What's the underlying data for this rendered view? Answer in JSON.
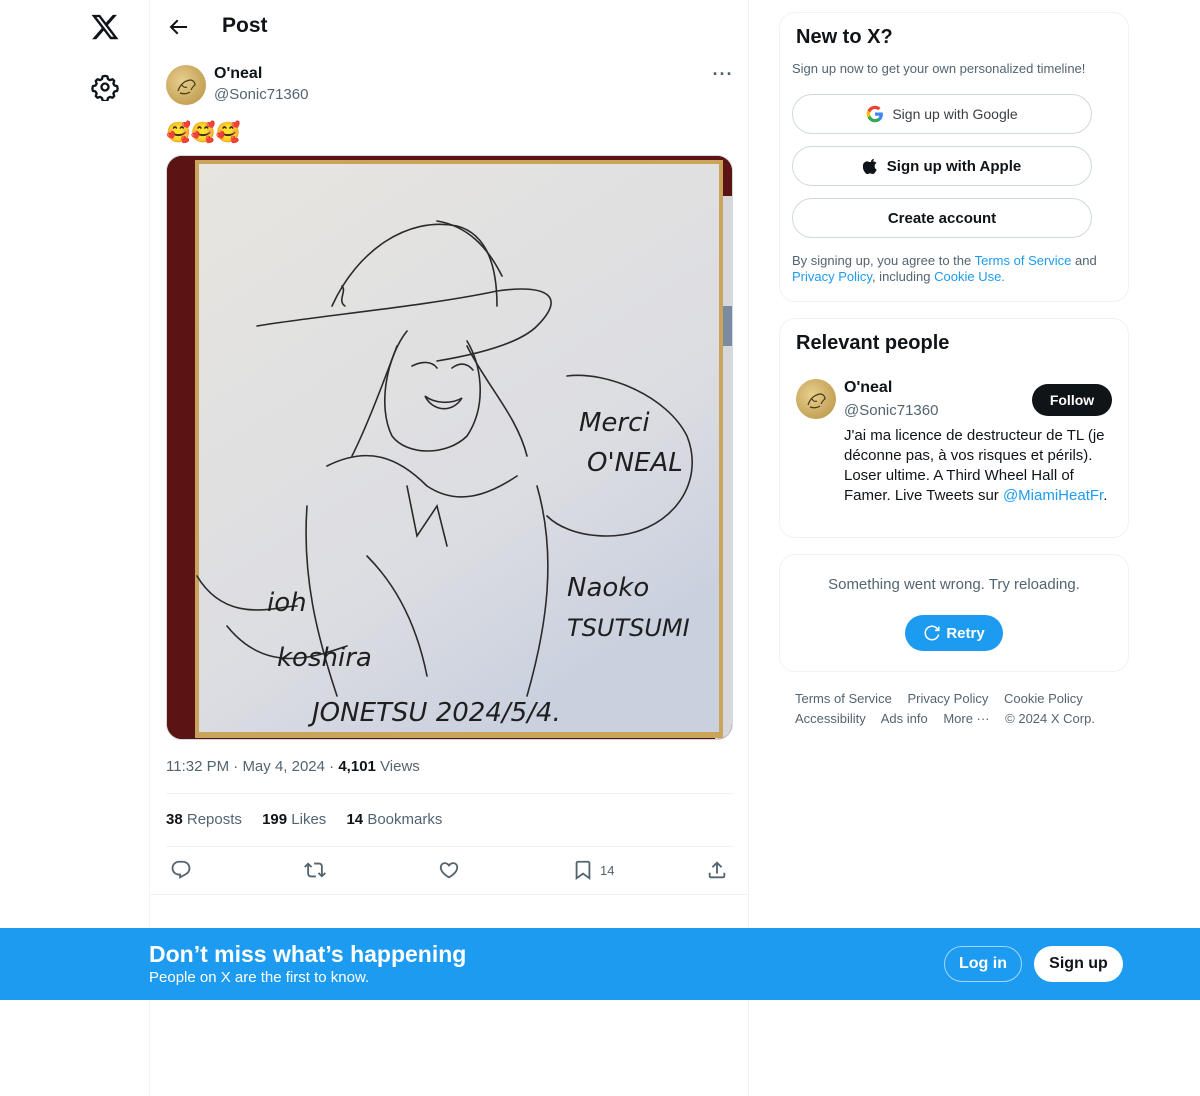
{
  "header": {
    "title": "Post"
  },
  "post": {
    "author_name": "O'neal",
    "author_handle": "@Sonic71360",
    "text": "🥰🥰🥰",
    "media_alt": "Signed shikishi sketch of a girl in a wide-brimmed hat",
    "media_text": {
      "merci": "Merci",
      "oneal": "O'NEAL",
      "naoko": "Naoko",
      "tsutsumi": "TSUTSUMI",
      "ioh": "ioh",
      "koshiras": "koshira",
      "jonetsu": "JONETSU 2024/5/4."
    },
    "time": "11:32 PM",
    "date": "May 4, 2024",
    "views_count": "4,101",
    "views_label": "Views",
    "reposts_count": "38",
    "reposts_label": "Reposts",
    "likes_count": "199",
    "likes_label": "Likes",
    "bookmarks_count": "14",
    "bookmarks_label": "Bookmarks",
    "bookmark_action_count": "14"
  },
  "signup_card": {
    "title": "New to X?",
    "subtitle": "Sign up now to get your own personalized timeline!",
    "google_label": "Sign up with Google",
    "apple_label": "Sign up with Apple",
    "create_label": "Create account",
    "legal_prefix": "By signing up, you agree to the ",
    "terms_link": "Terms of Service",
    "legal_and": " and ",
    "privacy_link": "Privacy Policy",
    "legal_including": ", including ",
    "cookie_link": "Cookie Use."
  },
  "relevant_people": {
    "title": "Relevant people",
    "name": "O'neal",
    "handle": "@Sonic71360",
    "follow_label": "Follow",
    "bio": "J'ai ma licence de destructeur de TL (je déconne pas, à vos risques et périls). Loser ultime. A Third Wheel Hall of Famer. Live Tweets sur ",
    "bio_link": "@MiamiHeatFr",
    "bio_end": "."
  },
  "error_card": {
    "message": "Something went wrong. Try reloading.",
    "retry_label": "Retry"
  },
  "footer": {
    "terms": "Terms of Service",
    "privacy": "Privacy Policy",
    "cookie": "Cookie Policy",
    "accessibility": "Accessibility",
    "ads": "Ads info",
    "more": "More ···",
    "copyright": "© 2024 X Corp."
  },
  "banner": {
    "title": "Don’t miss what’s happening",
    "subtitle": "People on X are the first to know.",
    "login_label": "Log in",
    "signup_label": "Sign up"
  },
  "colors": {
    "accent": "#1d9bf0",
    "text": "#0f1419",
    "muted": "#536471"
  }
}
